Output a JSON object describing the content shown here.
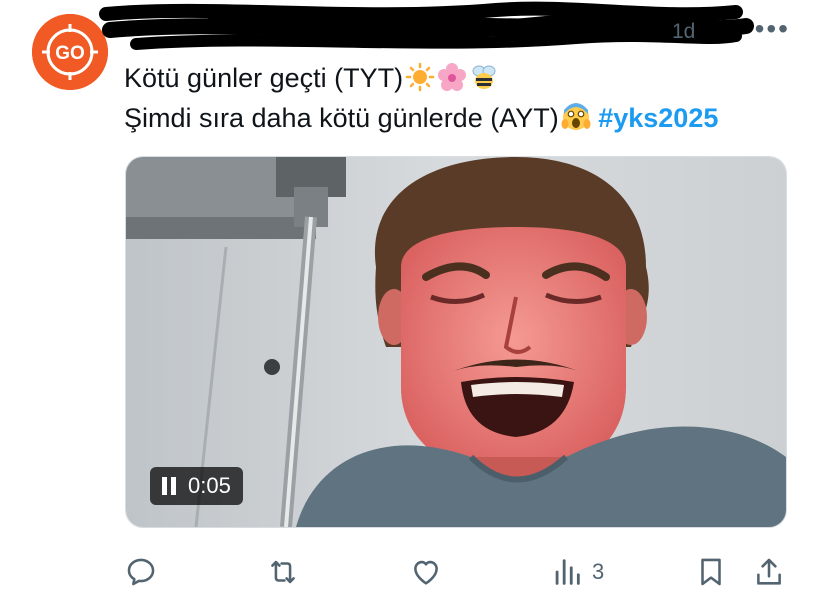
{
  "post": {
    "time": "1d",
    "more_label": "•••",
    "text_line1": "Kötü günler geçti (TYT)",
    "text_line2": "Şimdi sıra daha kötü günlerde (AYT)",
    "hashtag": "#yks2025",
    "emojis_line1": [
      "sun-emoji",
      "cherry-blossom-emoji",
      "bee-emoji"
    ],
    "emojis_line2": [
      "screaming-face-emoji"
    ]
  },
  "avatar": {
    "initials": "GO",
    "color": "#f15a24"
  },
  "video": {
    "time": "0:05",
    "state": "playing"
  },
  "actions": {
    "views_count": "3"
  },
  "colors": {
    "accent": "#1d9bf0",
    "muted": "#536471",
    "text": "#0f1419"
  }
}
